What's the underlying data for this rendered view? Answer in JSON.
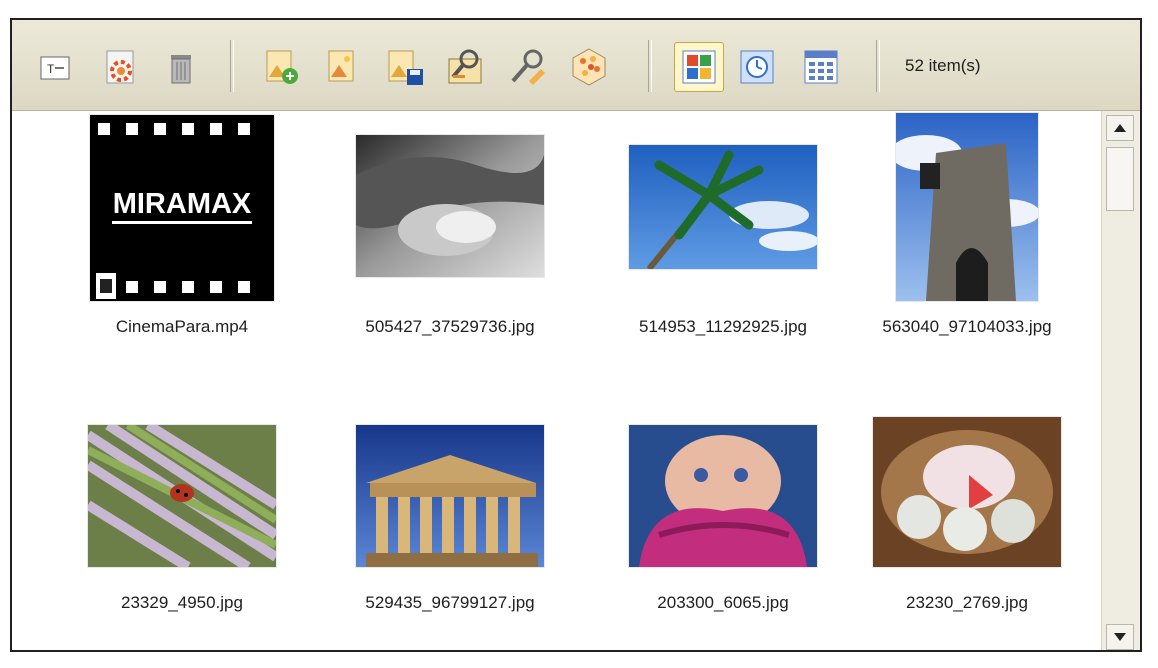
{
  "toolbar": {
    "buttons": [
      {
        "name": "text-icon"
      },
      {
        "name": "settings-icon"
      },
      {
        "name": "trash-icon"
      },
      {
        "name": "add-image-icon"
      },
      {
        "name": "edit-image-icon"
      },
      {
        "name": "save-image-icon"
      },
      {
        "name": "properties-icon"
      },
      {
        "name": "tools-icon"
      },
      {
        "name": "effects-icon"
      },
      {
        "name": "thumbnail-view-icon"
      },
      {
        "name": "timeline-view-icon"
      },
      {
        "name": "grid-view-icon"
      }
    ],
    "item_count": "52 item(s)"
  },
  "items": [
    {
      "caption": "CinemaPara.mp4",
      "thumb": "video-thumbnail"
    },
    {
      "caption": "505427_37529736.jpg",
      "thumb": "hands-photo"
    },
    {
      "caption": "514953_11292925.jpg",
      "thumb": "palm-tree-photo"
    },
    {
      "caption": "563040_97104033.jpg",
      "thumb": "tower-photo"
    },
    {
      "caption": "23329_4950.jpg",
      "thumb": "ladybug-photo"
    },
    {
      "caption": "529435_96799127.jpg",
      "thumb": "parthenon-photo"
    },
    {
      "caption": "203300_6065.jpg",
      "thumb": "baby-photo"
    },
    {
      "caption": "23230_2769.jpg",
      "thumb": "chicks-photo"
    }
  ],
  "video_logo_text": "MIRAMAX",
  "colors": {
    "toolbar_bg": "#ece9d8",
    "border": "#202020",
    "scrollbar_bg": "#efece2"
  }
}
